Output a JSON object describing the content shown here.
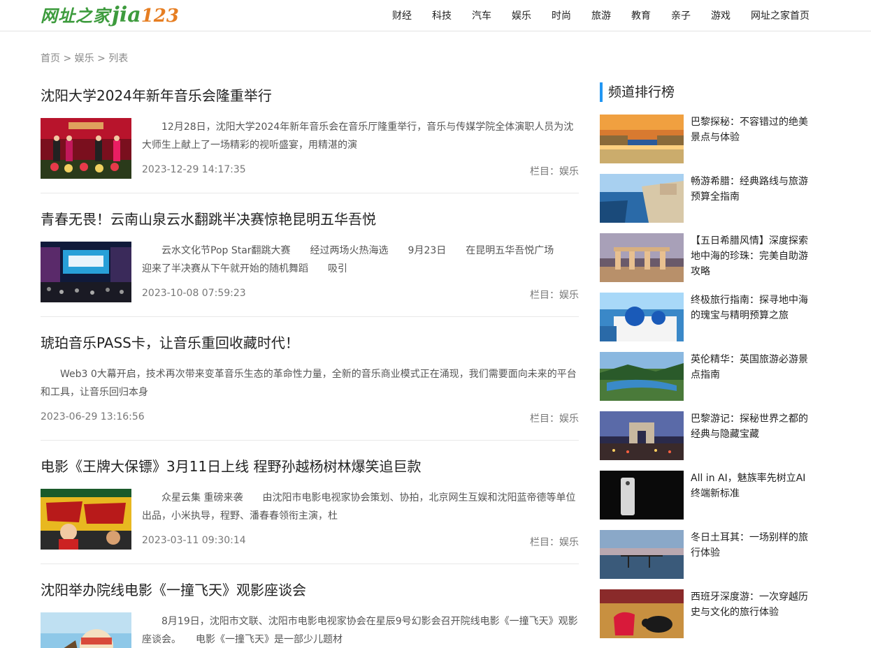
{
  "header": {
    "logo_cn": "网址之家",
    "logo_jia": "jia",
    "logo_num": "123",
    "nav": [
      "财经",
      "科技",
      "汽车",
      "娱乐",
      "时尚",
      "旅游",
      "教育",
      "亲子",
      "游戏",
      "网址之家首页"
    ]
  },
  "breadcrumb": {
    "home": "首页",
    "sep": " > ",
    "section": "娱乐",
    "page": "列表"
  },
  "articles": [
    {
      "title": "沈阳大学2024年新年音乐会隆重举行",
      "summary": "12月28日，沈阳大学2024年新年音乐会在音乐厅隆重举行，音乐与传媒学院全体演职人员为沈大师生上献上了一场精彩的视听盛宴，用精湛的演",
      "date": "2023-12-29 14:17:35",
      "category": "栏目：娱乐"
    },
    {
      "title": "青春无畏！云南山泉云水翻跳半决赛惊艳昆明五华吾悦",
      "summary": "云水文化节Pop Star翻跳大赛　　经过两场火热海选　　9月23日　　在昆明五华吾悦广场　　迎来了半决赛从下午就开始的随机舞蹈　　吸引",
      "date": "2023-10-08 07:59:23",
      "category": "栏目：娱乐"
    },
    {
      "title": "琥珀音乐PASS卡，让音乐重回收藏时代！",
      "summary": "Web3 0大幕开启，技术再次带来变革音乐生态的革命性力量，全新的音乐商业模式正在涌现，我们需要面向未来的平台和工具，让音乐回归本身",
      "date": "2023-06-29 13:16:56",
      "category": "栏目：娱乐"
    },
    {
      "title": "电影《王牌大保镖》3月11日上线 程野孙越杨树林爆笑追巨款",
      "summary": "众星云集 重磅来袭　　由沈阳市电影电视家协会策划、协拍，北京网生互娱和沈阳蓝帝德等单位出品，小米执导，程野、潘春春领衔主演，杜",
      "date": "2023-03-11 09:30:14",
      "category": "栏目：娱乐"
    },
    {
      "title": "沈阳举办院线电影《一撞飞天》观影座谈会",
      "summary": "8月19日，沈阳市文联、沈阳市电影电视家协会在星辰9号幻影会召开院线电影《一撞飞天》观影座谈会。　　电影《一撞飞天》是一部少儿题材",
      "date": "",
      "category": ""
    }
  ],
  "sidebar": {
    "title": "频道排行榜",
    "items": [
      "巴黎探秘：不容错过的绝美景点与体验",
      "畅游希腊：经典路线与旅游预算全指南",
      "【五日希腊风情】深度探索地中海的珍珠：完美自助游攻略",
      "终极旅行指南：探寻地中海的瑰宝与精明预算之旅",
      "英伦精华：英国旅游必游景点指南",
      "巴黎游记：探秘世界之都的经典与隐藏宝藏",
      "All in AI，魅族率先树立AI终端新标准",
      "冬日土耳其：一场别样的旅行体验",
      "西班牙深度游：一次穿越历史与文化的旅行体验"
    ]
  }
}
